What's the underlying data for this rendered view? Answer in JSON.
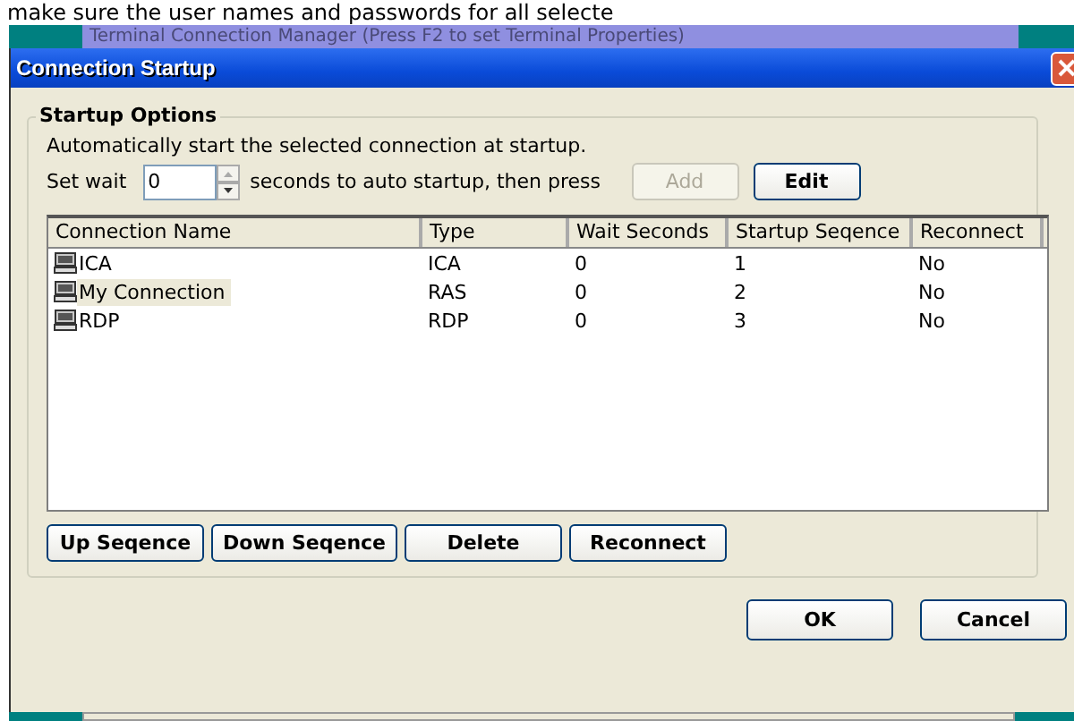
{
  "page_text": "make sure the user names and passwords for all selecte",
  "background_window": {
    "title": "Terminal Connection Manager (Press F2 to set Terminal Properties)"
  },
  "dialog": {
    "title": "Connection Startup",
    "group_title": "Startup Options",
    "description": "Automatically start the selected connection at startup.",
    "wait": {
      "label": "Set wait",
      "value": "0",
      "suffix": "seconds to auto startup, then press"
    },
    "action_buttons": [
      {
        "label": "Add",
        "disabled": true
      },
      {
        "label": "Edit",
        "disabled": false
      }
    ],
    "table": {
      "columns": [
        "Connection Name",
        "Type",
        "Wait Seconds",
        "Startup Seqence",
        "Reconnect"
      ],
      "rows": [
        {
          "cells": [
            "ICA",
            "ICA",
            "0",
            "1",
            "No"
          ],
          "selected": false
        },
        {
          "cells": [
            "My Connection",
            "RAS",
            "0",
            "2",
            "No"
          ],
          "selected": true
        },
        {
          "cells": [
            "RDP",
            "RDP",
            "0",
            "3",
            "No"
          ],
          "selected": false
        }
      ]
    },
    "list_buttons": [
      "Up Seqence",
      "Down Seqence",
      "Delete",
      "Reconnect"
    ],
    "footer_buttons": [
      "OK",
      "Cancel"
    ]
  }
}
